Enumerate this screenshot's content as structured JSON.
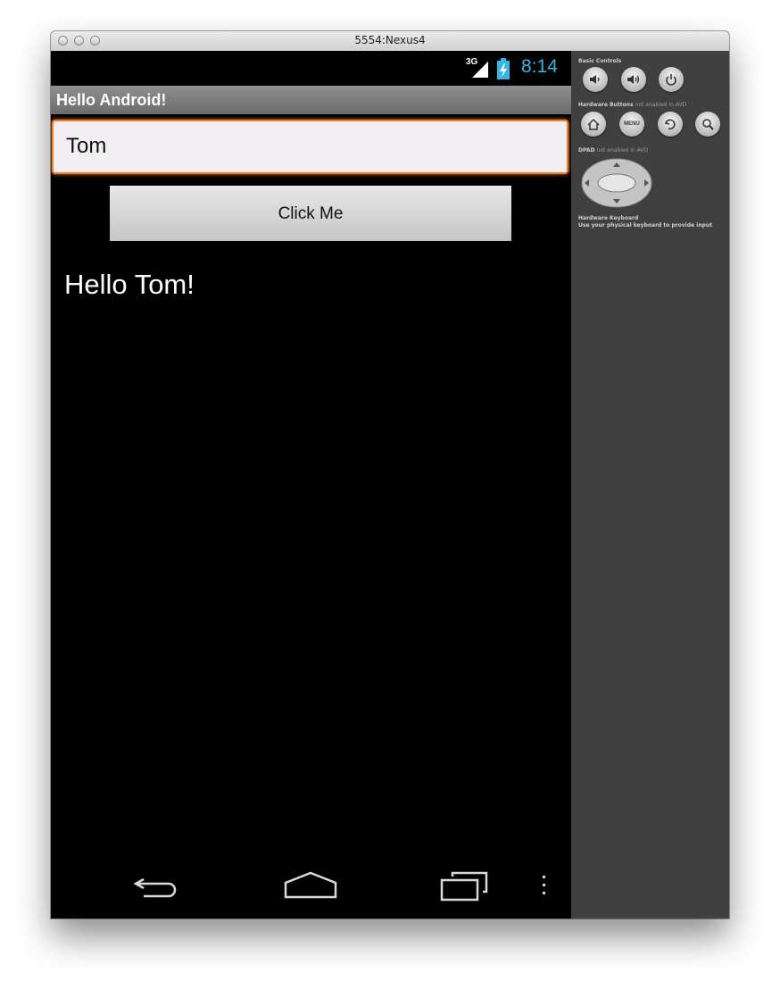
{
  "window": {
    "title": "5554:Nexus4"
  },
  "status_bar": {
    "network": "3G",
    "time": "8:14",
    "accent_color": "#33b5e5"
  },
  "app": {
    "title": "Hello Android!",
    "name_input": {
      "value": "Tom"
    },
    "click_button": {
      "label": "Click Me"
    },
    "greeting": "Hello Tom!"
  },
  "nav_bar": {
    "icons": [
      "back-icon",
      "home-icon",
      "recent-apps-icon",
      "overflow-menu-icon"
    ]
  },
  "controls_panel": {
    "basic_controls_label": "Basic Controls",
    "basic_controls": [
      "volume-down-icon",
      "volume-up-icon",
      "power-icon"
    ],
    "hardware_buttons_label": "Hardware Buttons",
    "hardware_buttons_note": "not enabled in AVD",
    "hardware_buttons": [
      "home-icon",
      "menu-icon",
      "back-icon",
      "search-icon"
    ],
    "menu_button_label": "MENU",
    "dpad_label": "DPAD",
    "dpad_note": "not enabled in AVD",
    "keyboard_label": "Hardware Keyboard",
    "keyboard_note": "Use your physical keyboard to provide input"
  }
}
